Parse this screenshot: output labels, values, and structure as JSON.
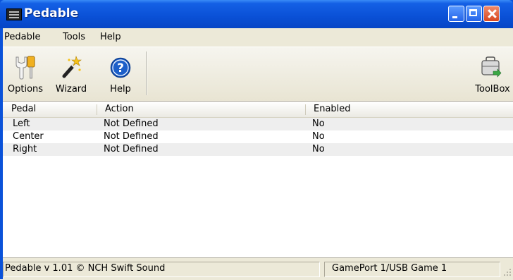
{
  "window": {
    "title": "Pedable"
  },
  "menu": [
    "Pedable",
    "Tools",
    "Help"
  ],
  "toolbar": {
    "options": "Options",
    "wizard": "Wizard",
    "help": "Help",
    "toolbox": "ToolBox"
  },
  "table": {
    "columns": [
      "Pedal",
      "Action",
      "Enabled"
    ],
    "rows": [
      {
        "pedal": "Left",
        "action": "Not Defined",
        "enabled": "No"
      },
      {
        "pedal": "Center",
        "action": "Not Defined",
        "enabled": "No"
      },
      {
        "pedal": "Right",
        "action": "Not Defined",
        "enabled": "No"
      }
    ]
  },
  "status": {
    "left": "Pedable v 1.01 © NCH Swift Sound",
    "right": "GamePort 1/USB Game 1"
  },
  "icons": {
    "app": "film-strip-icon",
    "options": "wrench-screwdriver-icon",
    "wizard": "magic-wand-icon",
    "help": "question-mark-icon",
    "toolbox": "toolbox-icon"
  },
  "colors": {
    "titlebar": "#0a52d9",
    "close_button": "#d8471f",
    "help_icon": "#1c5fc9"
  }
}
